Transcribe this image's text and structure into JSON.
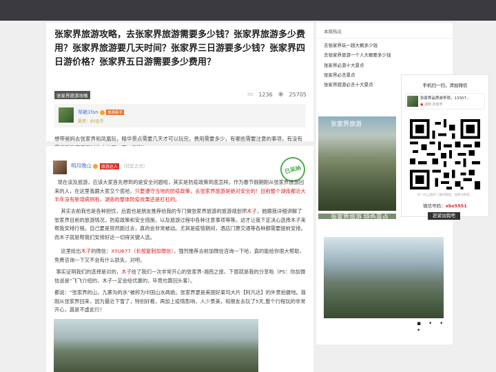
{
  "article": {
    "title": "张家界旅游攻略，去张家界旅游需要多少钱？张家界旅游多少费用？张家界旅游要几天时间？张家界三日游要多少钱？张家界四日游价格？张家界五日游需要多少费用？",
    "tag": "张家界旅游攻略",
    "comments": "1236",
    "views": "25705",
    "author": {
      "name": "琴箱1fan",
      "level_badge": "旅游新手",
      "meta": "悬赏：60金币"
    },
    "question": "想带爸妈去张家界和凤凰玩，精华景点需要几天才可以玩完，费用需要多少，有哪些需要注意的事项，有没有最近到张家界玩过的人分享一下，谢谢！"
  },
  "answer": {
    "author_name": "明月晚山",
    "author_badge": "旅游达人",
    "social": "（社区之光）",
    "stamp": "已采纳",
    "p1a": "现在谈及旅游，应该大家首先想到的是安全问题啦，其实是防疫政策到底怎样。作为春节假期刚从张家界旅游回来的人，在这里我跟大家交个底哈，",
    "p1red": "只要遵守当地的防疫政策，去张家界旅游是绝对安全的！目前整个湖南都近大半年没有新增病例啦，湖南的整体防疫效果还是杠杠的。",
    "p2a": "其实去前我也是各种担忧，后面也是朋友推荐给我的专门做张家界旅游的旅游规划师",
    "p2red": "木子",
    "p2b": "，她跟我详细讲解了张家界目前的旅游情况，防疫政策和安全措施，以及旅游过程中各种注意事项等等。这才让我下定决心选择木子来帮我安排行程。自己要是贸然跑过去，真的会非常被动。尤其是疫情期间，酒店门票交通等各种都需要提前安排。而木子就是帮我们安排好这一切得关键人选。",
    "p3a": "这里给出",
    "p3red": "木子",
    "p3b": "的微信：",
    "p3red2": "XYU677（长按复制加微信）",
    "p3c": "，强烈推荐去前加微信咨询一下哈，真的能给你很大帮助，免费咨询一下又不会有什么损失，对吧。",
    "p4a": "事实证明我们的选择是对的，",
    "p4red": "木子",
    "p4b": "给了我们一次非常开心的张家界-湘西之旅，下面就是我的分享啦（PS：你加微信说是“飞飞介绍的，木子一定会给优惠的，毕竟也算回头客）。",
    "p5": "都说：“张家界的山，九寨沟的水”被称为中国山水两绝。张家界更是美国好莱坞大片【阿凡达】的外景拍摄地。我刚从张家界回来，因为最近下雪了，特别好看，再加上疫情影响，人少景美，和朋友去玩了5天,整个行程玩的非常开心，真是不虚此行！"
  },
  "sidebar": {
    "heading": "本周热议",
    "items": [
      "去张家界玩一趟大概多少钱",
      "去张家界旅游一个人大概要多少钱",
      "张家界必游十大景点",
      "张家界必去景点",
      "张家界旅游必去十大景点"
    ],
    "banner1": "张家界旅游",
    "banner2": "张家界旅游 特色景点"
  },
  "qr": {
    "title": "手机扫一扫，添加微信",
    "profile_name": "张家界品质游李艳，13307...",
    "profile_sub": "湖南 张家界",
    "hint": "扫一扫上面的二维码图案，加我为朋友。",
    "id_label": "微信号码：",
    "id_value": "xbx5551",
    "button": "赶紧加我吧"
  },
  "colors": {
    "topbar": "#3a3a3f",
    "highlight_red": "#e02020",
    "badge_orange": "#e8752b",
    "badge_red": "#d8322a",
    "stamp_green": "#4cae4c"
  }
}
